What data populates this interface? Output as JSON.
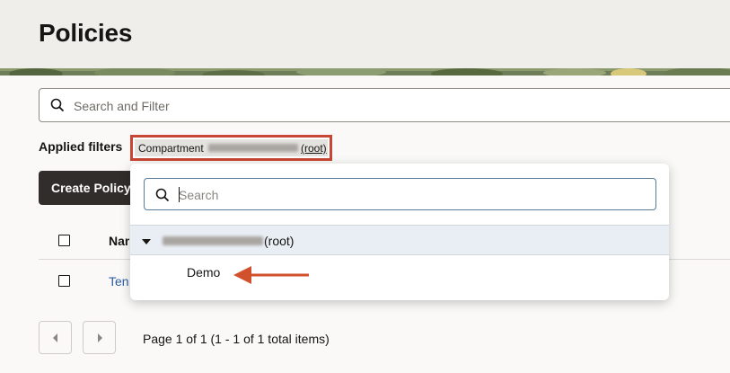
{
  "page": {
    "title": "Policies"
  },
  "search": {
    "placeholder": "Search and Filter"
  },
  "filters": {
    "label": "Applied filters",
    "chip_key": "Compartment",
    "chip_value_suffix": "(root)"
  },
  "toolbar": {
    "create_label": "Create Policy"
  },
  "table": {
    "columns": [
      "Name"
    ],
    "rows": [
      {
        "name": "Ten"
      }
    ]
  },
  "pagination": {
    "text": "Page 1 of 1 (1 - 1 of 1 total items)"
  },
  "compartment_dropdown": {
    "search_placeholder": "Search",
    "root_suffix": "(root)",
    "children": [
      "Demo"
    ]
  },
  "colors": {
    "highlight": "#c74634",
    "arrow": "#d1512c",
    "button": "#312d2a",
    "link": "#2a5da8"
  }
}
